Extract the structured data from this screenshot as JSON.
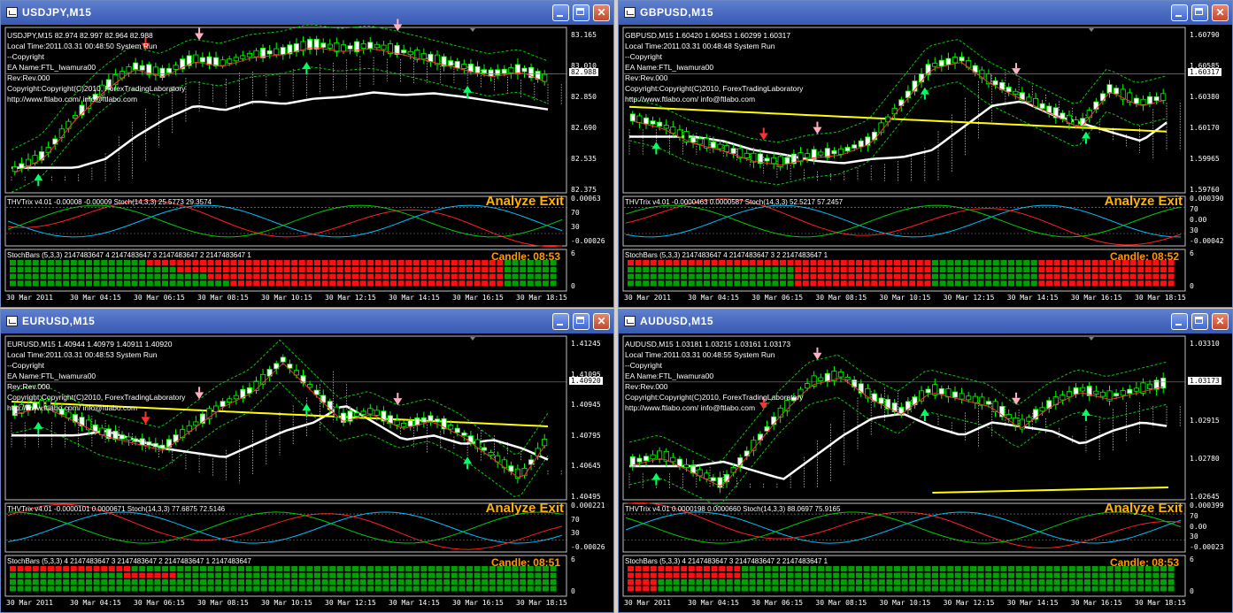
{
  "colors": {
    "up": "#00ff00",
    "down": "#ff0000",
    "white": "#ffffff",
    "yellow": "#ffff00",
    "orange": "#ffb300",
    "bg": "#000000",
    "title": "#4a6bc0"
  },
  "icons": {
    "app": "chart-window-icon",
    "minimize": "minimize-icon",
    "maximize": "maximize-icon",
    "close": "close-icon"
  },
  "windows": [
    {
      "id": "usdjpy",
      "title": "USDJPY,M15",
      "info": [
        "USDJPY,M15  82.974 82.997 82.964 82.988",
        "Local Time:2011.03.31 00:48:50 System Run",
        "--Copyright",
        "EA Name:FTL_Iwamura00",
        "Rev:Rev.000",
        "Copyright:Copyright(C)2010, ForexTradingLaboratory",
        "http://www.ftlabo.com/ info@ftlabo.com"
      ],
      "price_ticks": [
        "83.165",
        "83.010",
        "82.850",
        "82.690",
        "82.535",
        "82.375"
      ],
      "current_price": "82.988",
      "trix_label": "THVTrix v4.01 -0.00008 -0.00009  Stoch(14,3,3) 25.5773 29.3574",
      "trix_ticks": [
        "0.00063",
        "70",
        "30",
        "-0.00026"
      ],
      "analyze": "Analyze Exit",
      "sb_label": "StochBars (5,3,3) 2147483647 4 2147483647 3 2147483647 2 2147483647 1",
      "sb_ticks": [
        "6",
        "0"
      ],
      "candle": "Candle:  08:53",
      "time_axis": [
        "30 Mar 2011",
        "30 Mar 04:15",
        "30 Mar 06:15",
        "30 Mar 08:15",
        "30 Mar 10:15",
        "30 Mar 12:15",
        "30 Mar 14:15",
        "30 Mar 16:15",
        "30 Mar 18:15"
      ]
    },
    {
      "id": "gbpusd",
      "title": "GBPUSD,M15",
      "info": [
        "GBPUSD,M15  1.60420 1.60453 1.60299 1.60317",
        "Local Time:2011.03.31 00:48:48 System Run",
        "--Copyright",
        "EA Name:FTL_Iwamura00",
        "Rev:Rev.000",
        "Copyright:Copyright(C)2010, ForexTradingLaboratory",
        "http://www.ftlabo.com/ info@ftlabo.com"
      ],
      "price_ticks": [
        "1.60790",
        "1.60585",
        "1.60380",
        "1.60170",
        "1.59965",
        "1.59760"
      ],
      "current_price": "1.60317",
      "trix_label": "THVTrix v4.01 -0.0000463 0.0000587  Stoch(14,3,3) 52.5217 57.2457",
      "trix_ticks": [
        "0.000390",
        "70",
        "0.00",
        "30",
        "-0.00042"
      ],
      "analyze": "Analyze Exit",
      "sb_label": "StochBars (5,3,3) 2147483647 4 2147483647 3 2 2147483647 1",
      "sb_ticks": [
        "6",
        "0"
      ],
      "candle": "Candle:  08:52",
      "time_axis": [
        "30 Mar 2011",
        "30 Mar 04:15",
        "30 Mar 06:15",
        "30 Mar 08:15",
        "30 Mar 10:15",
        "30 Mar 12:15",
        "30 Mar 14:15",
        "30 Mar 16:15",
        "30 Mar 18:15"
      ]
    },
    {
      "id": "eurusd",
      "title": "EURUSD,M15",
      "info": [
        "EURUSD,M15  1.40944 1.40979 1.40911 1.40920",
        "Local Time:2011.03.31 00:48:53 System Run",
        "--Copyright",
        "EA Name:FTL_Iwamura00",
        "Rev:Rev.000",
        "Copyright:Copyright(C)2010, ForexTradingLaboratory",
        "http://www.ftlabo.com/ info@ftlabo.com"
      ],
      "price_ticks": [
        "1.41245",
        "1.41095",
        "1.40945",
        "1.40795",
        "1.40645",
        "1.40495"
      ],
      "current_price": "1.40920",
      "trix_label": "THVTrix v4.01 -0.0000101 0.0000671  Stoch(14,3,3) 77.6875 72.5146",
      "trix_ticks": [
        "0.000221",
        "70",
        "30",
        "-0.00026"
      ],
      "analyze": "Analyze Exit",
      "sb_label": "StochBars (5,3,3) 4 2147483647 3 2147483647 2 2147483647 1 2147483647",
      "sb_ticks": [
        "6",
        "0"
      ],
      "candle": "Candle:  08:51",
      "time_axis": [
        "30 Mar 2011",
        "30 Mar 04:15",
        "30 Mar 06:15",
        "30 Mar 08:15",
        "30 Mar 10:15",
        "30 Mar 12:15",
        "30 Mar 14:15",
        "30 Mar 16:15",
        "30 Mar 18:15"
      ]
    },
    {
      "id": "audusd",
      "title": "AUDUSD,M15",
      "info": [
        "AUDUSD,M15  1.03181 1.03215 1.03161 1.03173",
        "Local Time:2011.03.31 00:48:55 System Run",
        "--Copyright",
        "EA Name:FTL_Iwamura00",
        "Rev:Rev.000",
        "Copyright:Copyright(C)2010, ForexTradingLaboratory",
        "http://www.ftlabo.com/ info@ftlabo.com"
      ],
      "price_ticks": [
        "1.03310",
        "1.03045",
        "1.02915",
        "1.02780",
        "1.02645"
      ],
      "current_price": "1.03173",
      "trix_label": "THVTrix v4.01 0.0000198 0.0000660  Stoch(14,3,3) 88.0697 75.9165",
      "trix_ticks": [
        "0.000399",
        "70",
        "0.00",
        "30",
        "-0.00023"
      ],
      "analyze": "Analyze Exit",
      "sb_label": "StochBars (5,3,3) 4 2147483647 3 2147483647 2 2147483647 1",
      "sb_ticks": [
        "6",
        "0"
      ],
      "candle": "Candle:  08:53",
      "time_axis": [
        "30 Mar 2011",
        "30 Mar 04:15",
        "30 Mar 06:15",
        "30 Mar 08:15",
        "30 Mar 10:15",
        "30 Mar 12:15",
        "30 Mar 14:15",
        "30 Mar 16:15",
        "30 Mar 18:15"
      ]
    }
  ]
}
